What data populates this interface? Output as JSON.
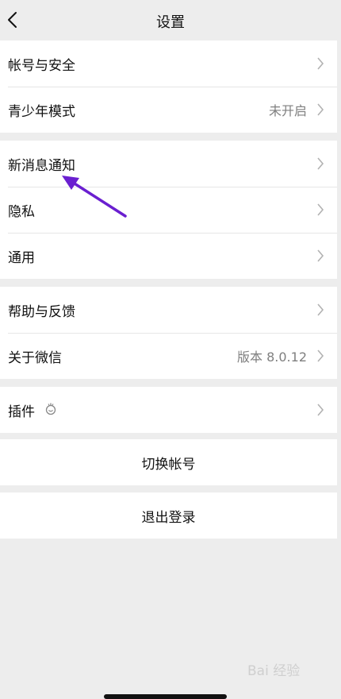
{
  "header": {
    "title": "设置",
    "back_icon": "chevron-left-icon"
  },
  "groups": [
    {
      "items": [
        {
          "label": "帐号与安全",
          "value": ""
        },
        {
          "label": "青少年模式",
          "value": "未开启"
        }
      ]
    },
    {
      "items": [
        {
          "label": "新消息通知",
          "value": ""
        },
        {
          "label": "隐私",
          "value": ""
        },
        {
          "label": "通用",
          "value": ""
        }
      ]
    },
    {
      "items": [
        {
          "label": "帮助与反馈",
          "value": ""
        },
        {
          "label": "关于微信",
          "value": "版本 8.0.12"
        }
      ]
    },
    {
      "items": [
        {
          "label": "插件",
          "value": "",
          "icon": "plugin-icon"
        }
      ]
    }
  ],
  "actions": {
    "switch_account": "切换帐号",
    "logout": "退出登录"
  },
  "annotation": {
    "color": "#6a1fd0",
    "icon": "arrow-annotation"
  },
  "watermark": "Bai 经验"
}
